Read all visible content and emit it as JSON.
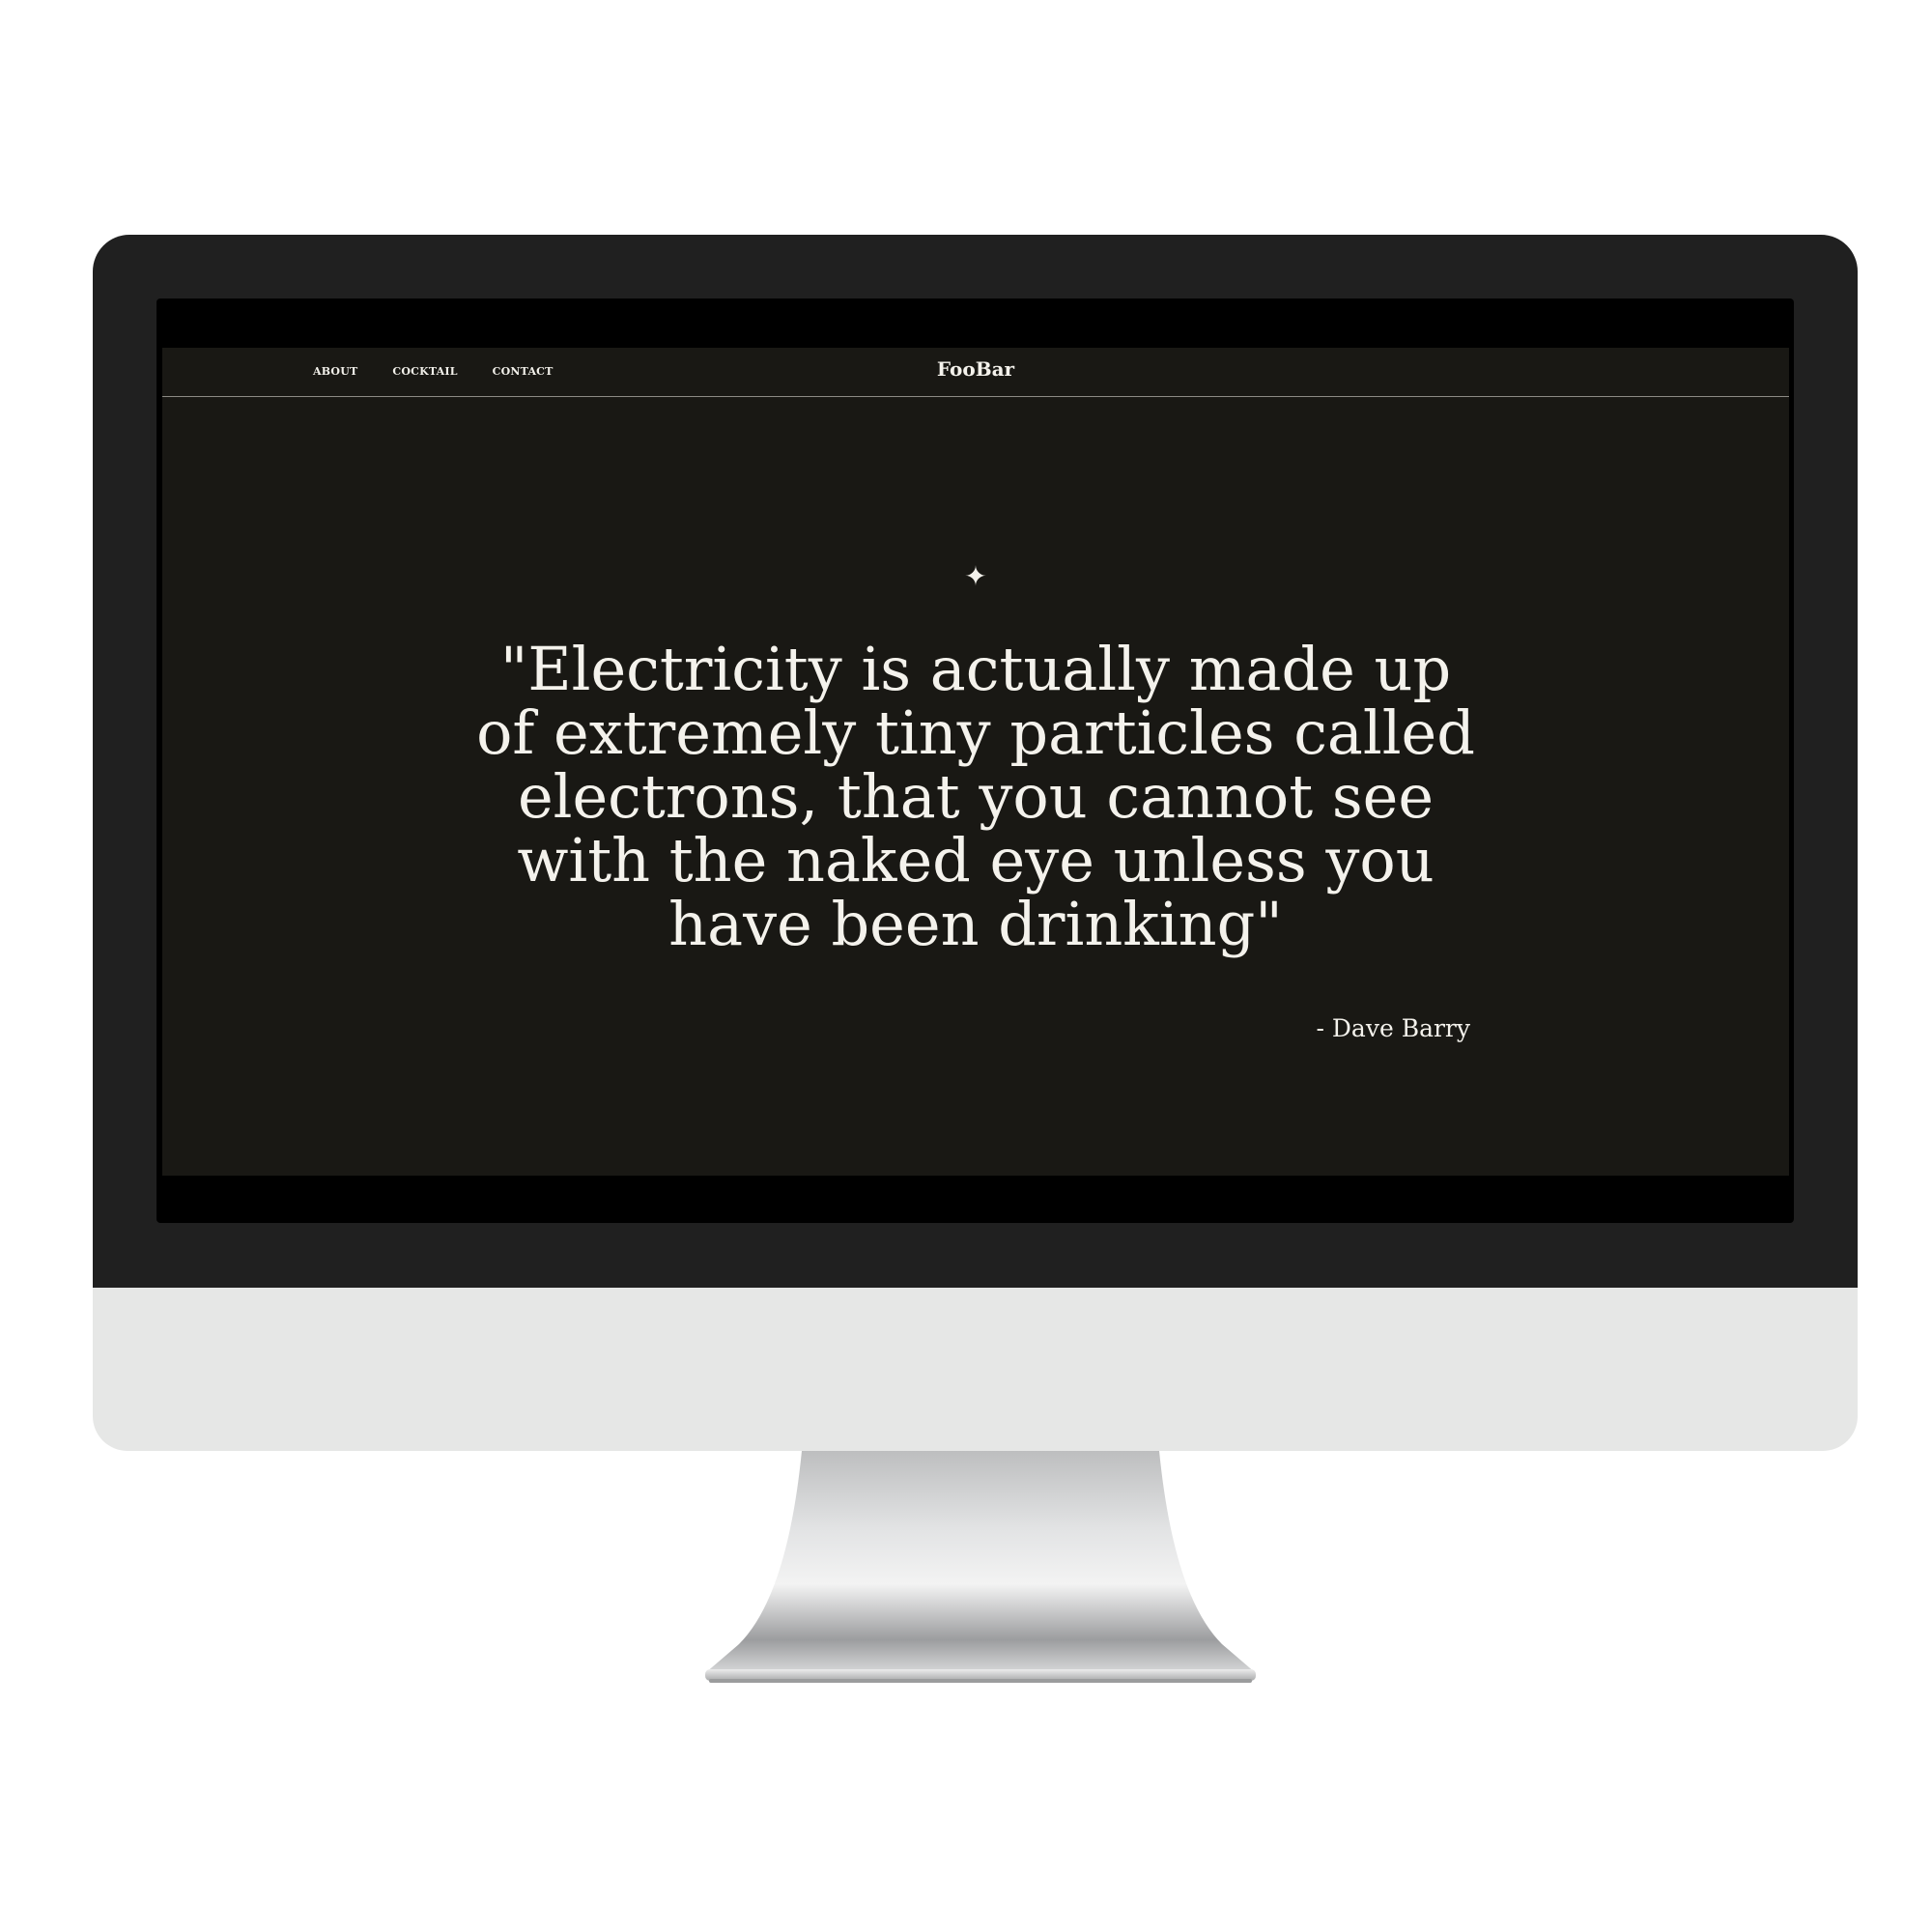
{
  "site": {
    "brand": "FooBar",
    "nav": [
      {
        "label": "ABOUT"
      },
      {
        "label": "COCKTAIL"
      },
      {
        "label": "CONTACT"
      }
    ]
  },
  "hero": {
    "ornament": "✦",
    "quote": "\"Electricity is actually made up of extremely tiny particles called electrons, that you cannot see with the naked eye unless you have been drinking\"",
    "author": "- Dave Barry"
  },
  "colors": {
    "page_background": "#191814",
    "text": "#f4f2ec",
    "bezel": "#202020",
    "chin": "#e6e7e6"
  }
}
